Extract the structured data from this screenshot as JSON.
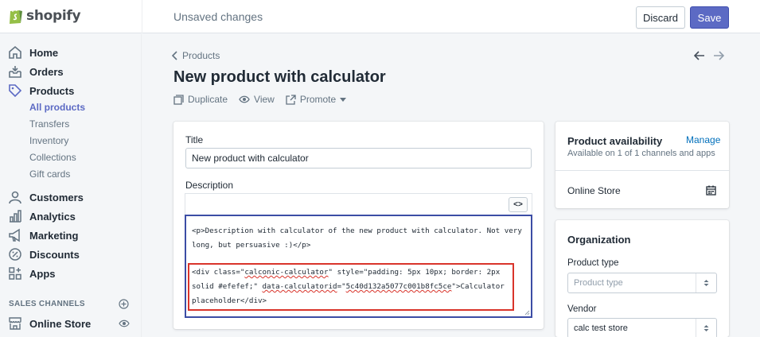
{
  "app": {
    "logo_text": "shopify"
  },
  "topbar": {
    "status": "Unsaved changes",
    "discard_label": "Discard",
    "save_label": "Save"
  },
  "sidebar": {
    "items": [
      {
        "label": "Home",
        "icon": "home-icon"
      },
      {
        "label": "Orders",
        "icon": "orders-icon"
      },
      {
        "label": "Products",
        "icon": "tag-icon"
      },
      {
        "label": "Customers",
        "icon": "person-icon"
      },
      {
        "label": "Analytics",
        "icon": "bar-chart-icon"
      },
      {
        "label": "Marketing",
        "icon": "megaphone-icon"
      },
      {
        "label": "Discounts",
        "icon": "discount-icon"
      },
      {
        "label": "Apps",
        "icon": "apps-icon"
      }
    ],
    "product_subitems": [
      "All products",
      "Transfers",
      "Inventory",
      "Collections",
      "Gift cards"
    ],
    "active_subitem": "All products",
    "sales_channels_title": "SALES CHANNELS",
    "channel": {
      "label": "Online Store",
      "icon": "store-icon"
    }
  },
  "page": {
    "breadcrumb": "Products",
    "title": "New product with calculator",
    "actions": {
      "duplicate": "Duplicate",
      "view": "View",
      "promote": "Promote"
    }
  },
  "form": {
    "title_label": "Title",
    "title_value": "New product with calculator",
    "description_label": "Description",
    "code_toggle": "<>",
    "description_html_p": "<p>Description with calculator of the new product with calculator. Not very long, but persuasive :)</p>",
    "description_html_div": {
      "open": "<div class=\"",
      "class_value": "calconic-calculator",
      "style_part": "\" style=\"padding: 5px 10px; border: 2px solid #efefef;\" ",
      "attr_name": "data-calculatorid",
      "eq": "=\"",
      "calc_id": "5c40d132a5077c001b8fc5ce",
      "close": "\">Calculator placeholder</div>"
    }
  },
  "availability": {
    "title": "Product availability",
    "manage_label": "Manage",
    "summary": "Available on 1 of 1 channels and apps",
    "channel": "Online Store"
  },
  "organization": {
    "title": "Organization",
    "product_type_label": "Product type",
    "product_type_placeholder": "Product type",
    "vendor_label": "Vendor",
    "vendor_value": "calc test store"
  },
  "colors": {
    "accent": "#5c6ac4",
    "link": "#006fbb",
    "highlight": "#d9342b",
    "editor_border": "#3c4da5"
  }
}
